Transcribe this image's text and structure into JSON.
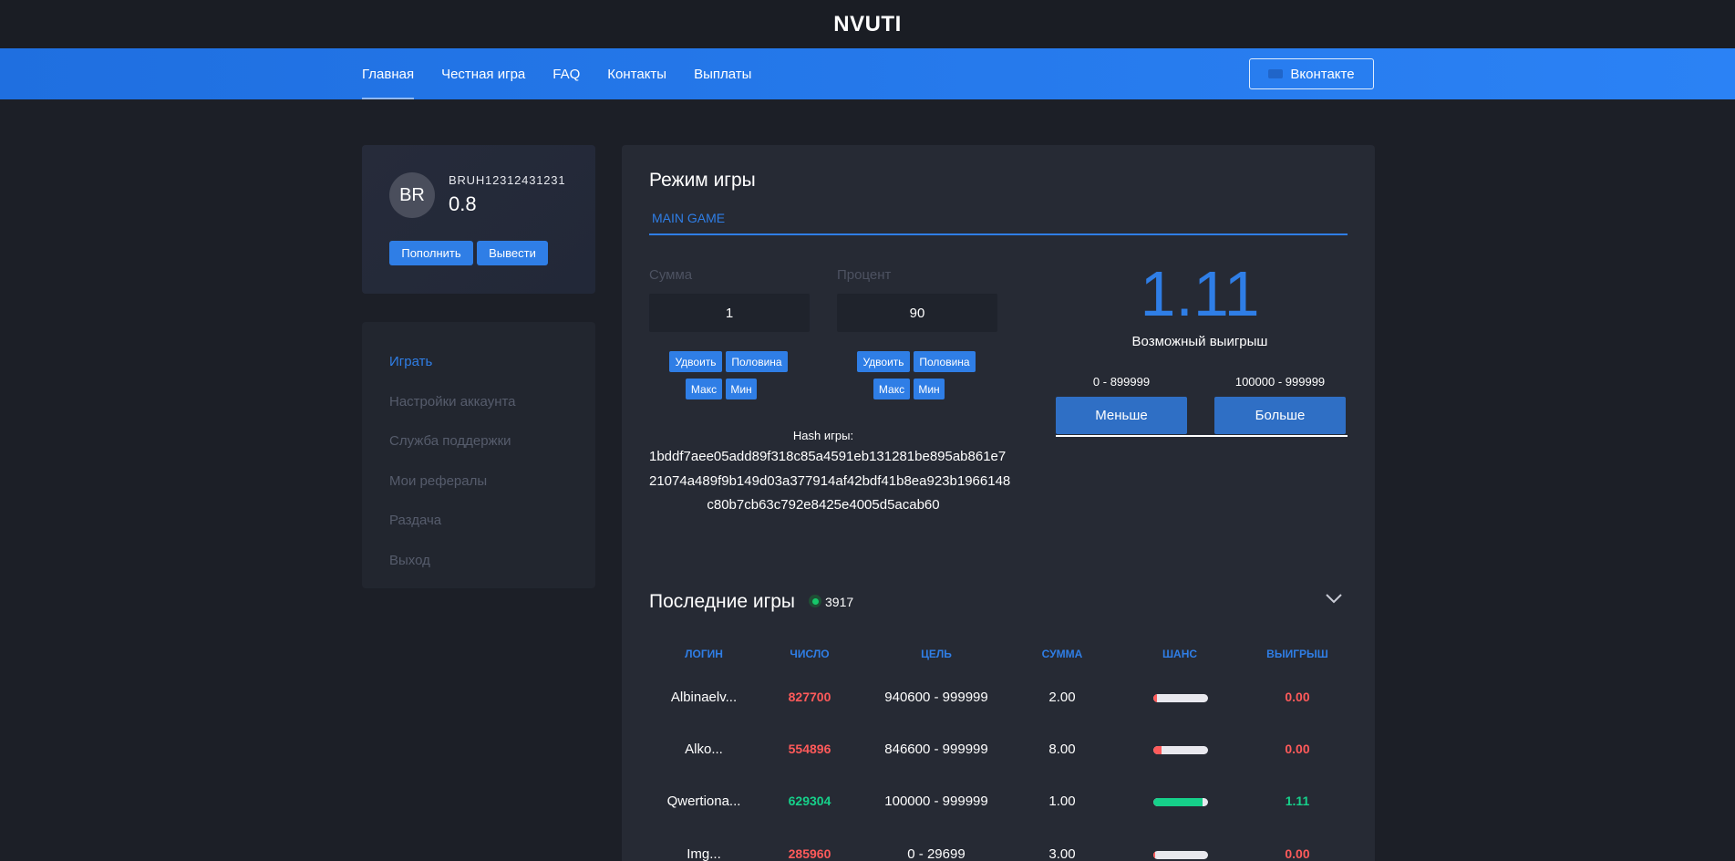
{
  "header": {
    "brand": "NVUTI"
  },
  "nav": {
    "items": [
      "Главная",
      "Честная игра",
      "FAQ",
      "Контакты",
      "Выплаты"
    ],
    "vk_label": "Вконтакте"
  },
  "profile": {
    "avatar_initials": "BR",
    "username": "BRUH12312431231",
    "balance": "0.8",
    "deposit_label": "Пополнить",
    "withdraw_label": "Вывести"
  },
  "side_menu": [
    "Играть",
    "Настройки аккаунта",
    "Служба поддержки",
    "Мои рефералы",
    "Раздача",
    "Выход"
  ],
  "game": {
    "title": "Режим игры",
    "tab": "MAIN GAME",
    "amount_label": "Сумма",
    "amount_value": "1",
    "percent_label": "Процент",
    "percent_value": "90",
    "double_label": "Удвоить",
    "half_label": "Половина",
    "max_label": "Макс",
    "min_label": "Мин",
    "hash_label": "Hash игры:",
    "hash_lines": [
      "1bddf7aee05add89f318c85a4591eb131281be895ab861e7",
      "21074a489f9b149d03a377914af42bdf41b8ea923b1966148",
      "c80b7cb63c792e8425e4005d5acab60"
    ],
    "possible_win": "1.11",
    "possible_win_label": "Возможный выигрыш",
    "less_range": "0 - 899999",
    "more_range": "100000 - 999999",
    "less_label": "Меньше",
    "more_label": "Больше"
  },
  "recent": {
    "title": "Последние игры",
    "online_count": "3917",
    "headers": [
      "ЛОГИН",
      "ЧИСЛО",
      "ЦЕЛЬ",
      "СУММА",
      "ШАНС",
      "ВЫИГРЫШ"
    ],
    "rows": [
      {
        "login": "Albinaelv...",
        "number": "827700",
        "target": "940600 - 999999",
        "amount": "2.00",
        "chance": 0.06,
        "win": "0.00",
        "status": "lose"
      },
      {
        "login": "Alko...",
        "number": "554896",
        "target": "846600 - 999999",
        "amount": "8.00",
        "chance": 0.15,
        "win": "0.00",
        "status": "lose"
      },
      {
        "login": "Qwertiona...",
        "number": "629304",
        "target": "100000 - 999999",
        "amount": "1.00",
        "chance": 0.9,
        "win": "1.11",
        "status": "win"
      },
      {
        "login": "Img...",
        "number": "285960",
        "target": "0 - 29699",
        "amount": "3.00",
        "chance": 0.03,
        "win": "0.00",
        "status": "lose"
      }
    ]
  },
  "colors": {
    "accent": "#2f7ee6",
    "win": "#16d08a",
    "lose": "#ff5a5a",
    "bg": "#1c1f27",
    "panel": "#262a34"
  }
}
